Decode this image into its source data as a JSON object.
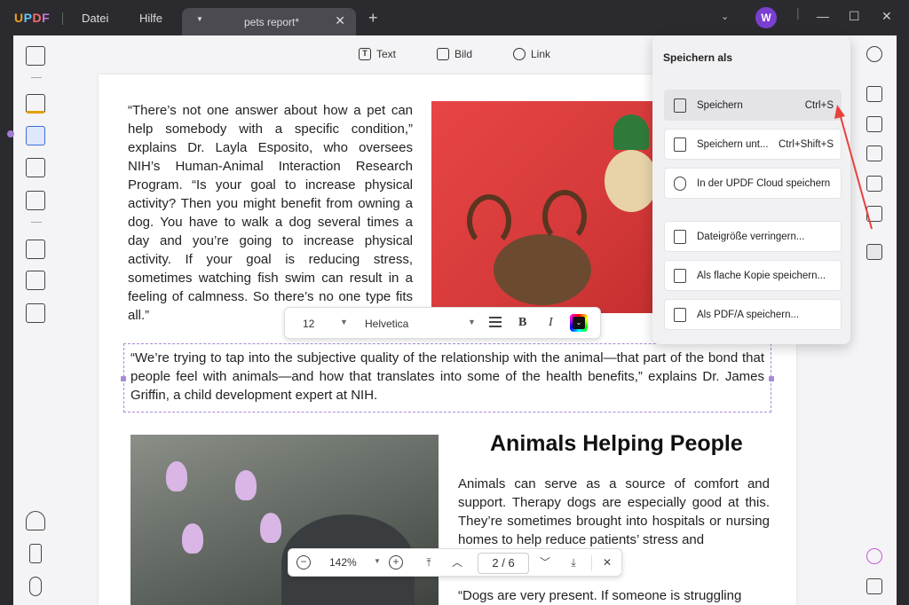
{
  "app": {
    "menu": [
      "Datei",
      "Hilfe"
    ],
    "tab_title": "pets report*",
    "avatar_initial": "W"
  },
  "toolbar": {
    "text_label": "Text",
    "image_label": "Bild",
    "link_label": "Link"
  },
  "document": {
    "para1": "“There’s not one answer about how a pet can help somebody with a specific condition,” explains Dr. Layla Esposito, who oversees NIH’s Human-Animal Interaction Research Program. “Is your goal to increase physical activity? Then you might benefit from owning a dog. You have to walk a dog several times a day and you’re going to increase physical activity. If your goal is reducing stress, sometimes watching fish swim can result in a feeling of calmness. So there’s no one type fits all.”",
    "quote": "“We’re trying to tap into the subjective quality of the relationship with the animal—that part of the bond that people feel with animals—and how that translates into some of the health benefits,” explains Dr. James Griffin, a child development expert at NIH.",
    "heading": "Animals Helping People",
    "para2": "Animals can serve as a source of comfort and support. Therapy dogs are especially good at this. They’re sometimes brought into hospitals or nursing homes to help reduce patients’ stress and",
    "para3": "“Dogs are very present. If someone is struggling"
  },
  "fontbar": {
    "size": "12",
    "family": "Helvetica",
    "bold": "B",
    "italic": "I"
  },
  "navbar": {
    "zoom": "142%",
    "page_current": "2",
    "page_separator": "/",
    "page_total": "6"
  },
  "save_menu": {
    "title": "Speichern als",
    "items": [
      {
        "label": "Speichern",
        "shortcut": "Ctrl+S"
      },
      {
        "label": "Speichern unt...",
        "shortcut": "Ctrl+Shift+S"
      },
      {
        "label": "In der UPDF Cloud speichern",
        "shortcut": ""
      },
      {
        "label": "Dateigröße verringern...",
        "shortcut": ""
      },
      {
        "label": "Als flache Kopie speichern...",
        "shortcut": ""
      },
      {
        "label": "Als PDF/A speichern...",
        "shortcut": ""
      }
    ]
  },
  "colors": {
    "accent": "#3a6fd8",
    "annotation_arrow": "#e8413a",
    "selection": "#a98ad8"
  }
}
